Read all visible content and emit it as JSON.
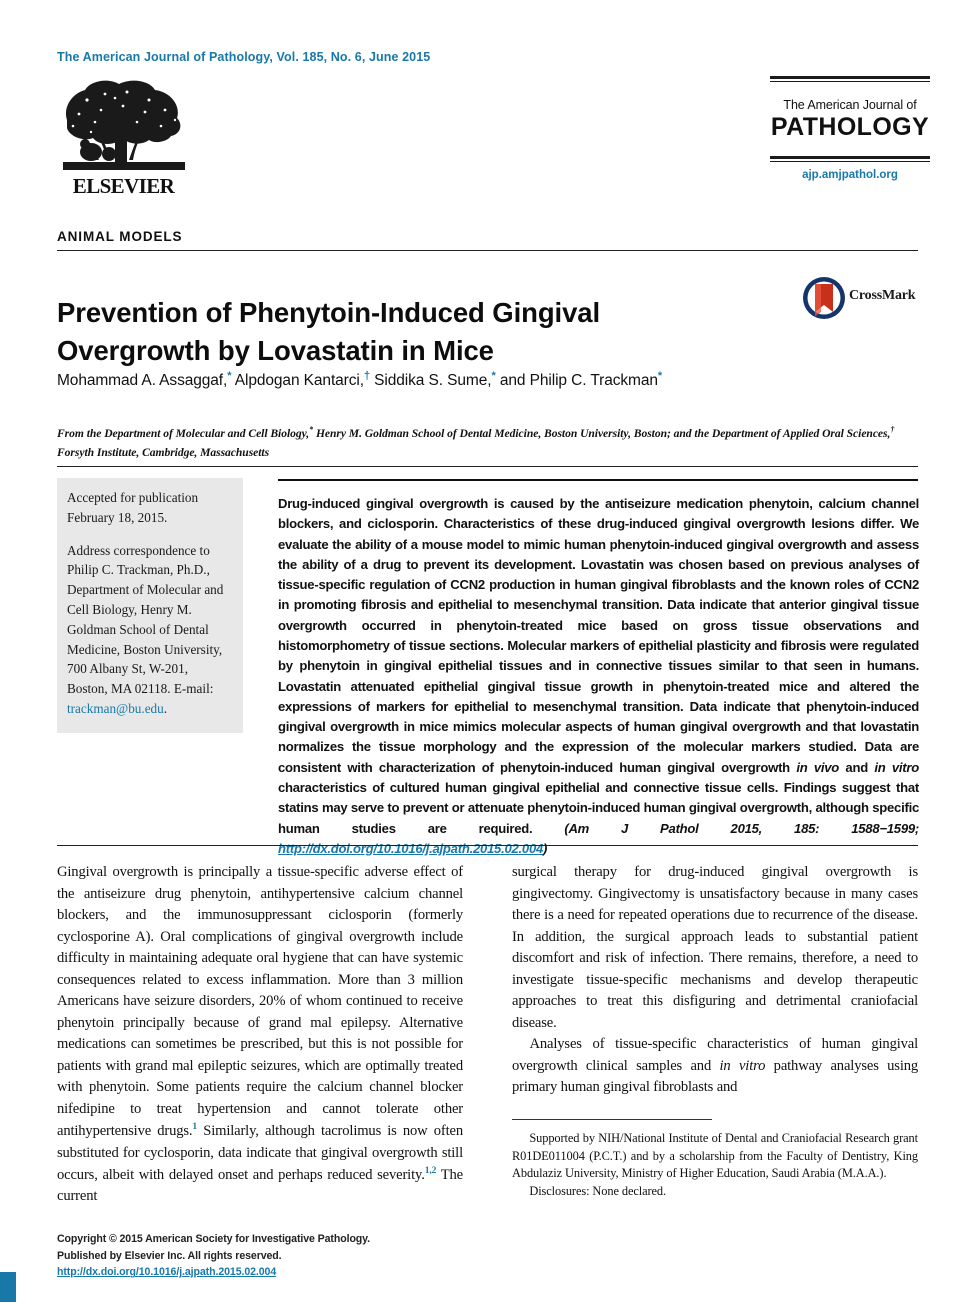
{
  "masthead": {
    "journal_line": "The American Journal of Pathology, Vol. 185, No. 6, June 2015",
    "publisher_name": "ELSEVIER",
    "publisher_logo_icon": "elsevier-tree-logo"
  },
  "journal_logo": {
    "sub": "The American Journal of",
    "main": "PATHOLOGY",
    "url": "ajp.amjpathol.org"
  },
  "article": {
    "kicker": "ANIMAL MODELS",
    "title": "Prevention of Phenytoin-Induced Gingival Overgrowth by Lovastatin in Mice",
    "authors_html": "Mohammad A. Assaggaf,<sup>*</sup> Alpdogan Kantarci,<sup>†</sup> Siddika S. Sume,<sup>*</sup> and Philip C. Trackman<sup>*</sup>",
    "affiliations_html": "From the Department of Molecular and Cell Biology,<sup>*</sup> Henry M. Goldman School of Dental Medicine, Boston University, Boston; and the Department of Applied Oral Sciences,<sup>†</sup> Forsyth Institute, Cambridge, Massachusetts",
    "crossmark_label": "CrossMark",
    "crossmark_icon": "crossmark-badge-icon"
  },
  "sidebar": {
    "accepted_label": "Accepted for publication February 18, 2015.",
    "correspondence": "Address correspondence to Philip C. Trackman, Ph.D., Department of Molecular and Cell Biology, Henry M. Goldman School of Dental Medicine, Boston University, 700 Albany St, W-201, Boston, MA 02118. E-mail:",
    "email": "trackman@bu.edu"
  },
  "abstract": {
    "text": "Drug-induced gingival overgrowth is caused by the antiseizure medication phenytoin, calcium channel blockers, and ciclosporin. Characteristics of these drug-induced gingival overgrowth lesions differ. We evaluate the ability of a mouse model to mimic human phenytoin-induced gingival overgrowth and assess the ability of a drug to prevent its development. Lovastatin was chosen based on previous analyses of tissue-specific regulation of CCN2 production in human gingival fibroblasts and the known roles of CCN2 in promoting fibrosis and epithelial to mesenchymal transition. Data indicate that anterior gingival tissue overgrowth occurred in phenytoin-treated mice based on gross tissue observations and histomorphometry of tissue sections. Molecular markers of epithelial plasticity and fibrosis were regulated by phenytoin in gingival epithelial tissues and in connective tissues similar to that seen in humans. Lovastatin attenuated epithelial gingival tissue growth in phenytoin-treated mice and altered the expressions of markers for epithelial to mesenchymal transition. Data indicate that phenytoin-induced gingival overgrowth in mice mimics molecular aspects of human gingival overgrowth and that lovastatin normalizes the tissue morphology and the expression of the molecular markers studied. Data are consistent with characterization of phenytoin-induced human gingival overgrowth ",
    "invivo": "in vivo",
    "mid1": " and ",
    "invitro": "in vitro",
    "text2": " characteristics of cultured human gingival epithelial and connective tissue cells. Findings suggest that statins may serve to prevent or attenuate phenytoin-induced human gingival overgrowth, although specific human studies are required. ",
    "citation": "(Am J Pathol 2015, 185: 1588−1599; ",
    "doi_url": "http://dx.doi.org/10.1016/j.ajpath.2015.02.004",
    "citation_close": ")"
  },
  "body": {
    "left_column": {
      "paragraph_1a": "Gingival overgrowth is principally a tissue-specific adverse effect of the antiseizure drug phenytoin, antihypertensive calcium channel blockers, and the immunosuppressant ciclosporin (formerly cyclosporine A). Oral complications of gingival overgrowth include difficulty in maintaining adequate oral hygiene that can have systemic consequences related to excess inflammation. More than 3 million Americans have seizure disorders, 20% of whom continued to receive phenytoin principally because of grand mal epilepsy. Alternative medications can sometimes be prescribed, but this is not possible for patients with grand mal epileptic seizures, which are optimally treated with phenytoin. Some patients require the calcium channel blocker nifedipine to treat hypertension and cannot tolerate other antihypertensive drugs.",
      "ref_1": "1",
      "paragraph_1b": " Similarly, although tacrolimus is now often substituted for cyclosporin, data indicate that gingival overgrowth still occurs, albeit with delayed onset and perhaps reduced severity.",
      "ref_12": "1,2",
      "paragraph_1c": " The current"
    },
    "right_column": {
      "paragraph_1": "surgical therapy for drug-induced gingival overgrowth is gingivectomy. Gingivectomy is unsatisfactory because in many cases there is a need for repeated operations due to recurrence of the disease. In addition, the surgical approach leads to substantial patient discomfort and risk of infection. There remains, therefore, a need to investigate tissue-specific mechanisms and develop therapeutic approaches to treat this disfiguring and detrimental craniofacial disease.",
      "paragraph_2a": "Analyses of tissue-specific characteristics of human gingival overgrowth clinical samples and ",
      "invitro": "in vitro",
      "paragraph_2b": " pathway analyses using primary human gingival fibroblasts and"
    }
  },
  "footnotes": {
    "support": "Supported by NIH/National Institute of Dental and Craniofacial Research grant R01DE011004 (P.C.T.) and by a scholarship from the Faculty of Dentistry, King Abdulaziz University, Ministry of Higher Education, Saudi Arabia (M.A.A.).",
    "disclosures": "Disclosures: None declared."
  },
  "footer": {
    "copyright_line1": "Copyright © 2015 American Society for Investigative Pathology.",
    "copyright_line2": "Published by Elsevier Inc. All rights reserved.",
    "doi": "http://dx.doi.org/10.1016/j.ajpath.2015.02.004"
  },
  "colors": {
    "accent_blue": "#1879a8",
    "sidebar_bg": "#e8e8e8",
    "text": "#111111"
  }
}
